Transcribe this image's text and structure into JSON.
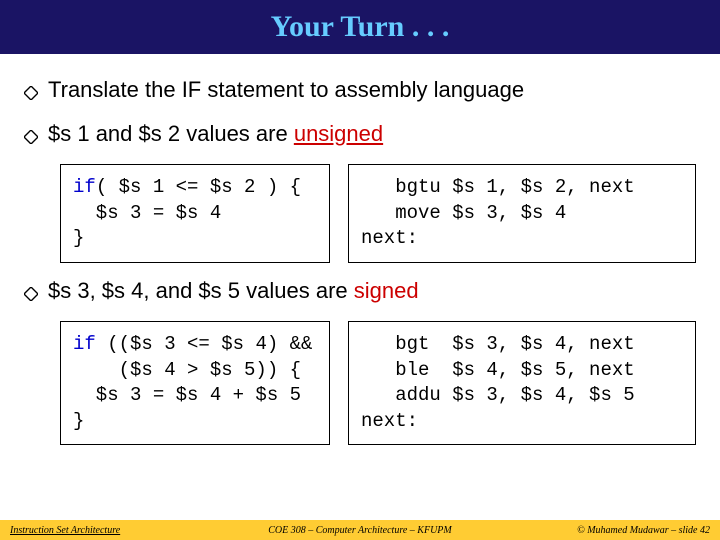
{
  "title": "Your Turn . . .",
  "bullet1": "Translate the IF statement to assembly language",
  "bullet2_pre": "$s 1 and $s 2 values are ",
  "bullet2_word": "unsigned",
  "bullet3_pre": "$s 3, $s 4, and $s 5 values are ",
  "bullet3_word": "signed",
  "code1_left_l1a": "if",
  "code1_left_l1b": "( $s 1 <= $s 2 ) {",
  "code1_left_l2": "  $s 3 = $s 4",
  "code1_left_l3": "}",
  "code1_right_l1": "   bgtu $s 1, $s 2, next",
  "code1_right_l2": "   move $s 3, $s 4",
  "code1_right_l3": "next:",
  "code2_left_l1a": "if ",
  "code2_left_l1b": "(($s 3 <= $s 4) &&",
  "code2_left_l2": "    ($s 4 > $s 5)) {",
  "code2_left_l3": "  $s 3 = $s 4 + $s 5",
  "code2_left_l4": "}",
  "code2_right_l1": "   bgt  $s 3, $s 4, next",
  "code2_right_l2": "   ble  $s 4, $s 5, next",
  "code2_right_l3": "   addu $s 3, $s 4, $s 5",
  "code2_right_l4": "next:",
  "footer_left": "Instruction Set Architecture",
  "footer_center": "COE 308 – Computer Architecture – KFUPM",
  "footer_right": "© Muhamed Mudawar – slide 42"
}
